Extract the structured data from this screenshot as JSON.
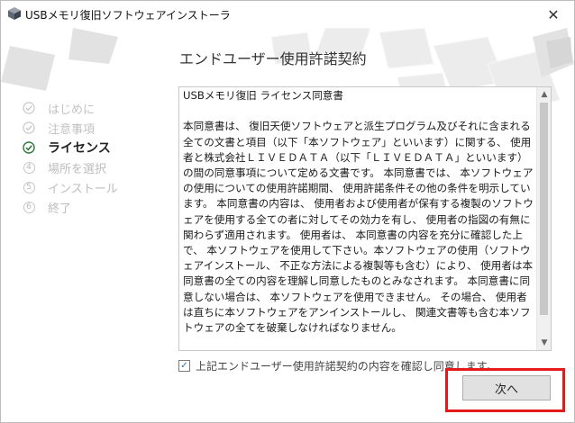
{
  "window": {
    "title": "USBメモリ復旧ソフトウェアインストーラ",
    "close_glyph": "✕"
  },
  "steps": [
    {
      "label": "はじめに",
      "state": "done"
    },
    {
      "label": "注意事項",
      "state": "done"
    },
    {
      "label": "ライセンス",
      "state": "active"
    },
    {
      "label": "場所を選択",
      "state": "pending",
      "num": "4"
    },
    {
      "label": "インストール",
      "state": "pending",
      "num": "5"
    },
    {
      "label": "終了",
      "state": "pending",
      "num": "6"
    }
  ],
  "heading": "エンドユーザー使用許諾契約",
  "license": {
    "title": "USBメモリ復旧 ライセンス同意書",
    "body": "本同意書は、 復旧天使ソフトウェアと派生プログラム及びそれに含まれる全ての文書と項目（以下「本ソフトウェア」といいます）に関する、 使用者と株式会社ＬＩＶＥＤＡＴＡ（以下「ＬＩＶＥＤＡＴＡ」といいます）の間の同意事項について定める文書です。 本同意書では、 本ソフトウェアの使用についての使用許諾期間、 使用許諾条件その他の条件を明示しています。 本同意書の内容は、 使用者および使用者が保有する複製のソフトウェアを使用する全ての者に対してその効力を有し、 使用者の指図の有無に関わらず適用されます。 使用者は、 本同意書の内容を充分に確認した上で、 本ソフトウェアを使用して下さい。本ソフトウェアの使用（ソフトウェアインストール、 不正な方法による複製等も含む）により、 使用者は本同意書の全ての内容を理解し同意したものとみなされます。 本同意書に同意しない場合は、 本ソフトウェアを使用できません。 その場合、 使用者は直ちに本ソフトウェアをアンインストールし、 関連文書等も含む本ソフトウェアの全てを破棄しなければなりません。"
  },
  "agree": {
    "label": "上記エンドユーザー使用許諾契約の内容を確認し同意します。",
    "checked": true,
    "check_glyph": "✓"
  },
  "next_button": "次へ",
  "icons": {
    "check_done": "check-circle-icon",
    "scroll_up": "▲",
    "scroll_down": "▼"
  },
  "colors": {
    "highlight": "#e31b1b",
    "active_check": "#2d7a3a",
    "done_check": "#c2c2c2"
  }
}
